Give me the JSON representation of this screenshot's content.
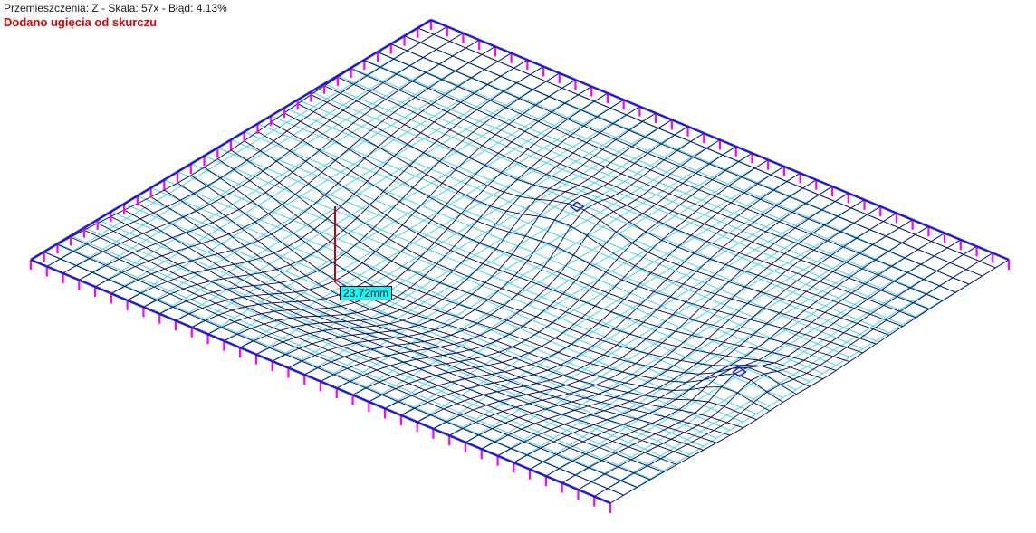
{
  "header": {
    "status_line": "Przemieszczenia: Z - Skala: 57x - Błąd: 4.13%",
    "note": "Dodano ugięcia od skurczu"
  },
  "measurement": {
    "label": "23.72mm"
  },
  "colors": {
    "deformed_mesh": "#000066",
    "undeformed_mesh": "#33d6e6",
    "support_marker": "#ff00ff",
    "support_edge": "#1a1aee",
    "note_text": "#e00000",
    "dimension_line": "#cc0000",
    "label_fill": "#00ffff"
  }
}
